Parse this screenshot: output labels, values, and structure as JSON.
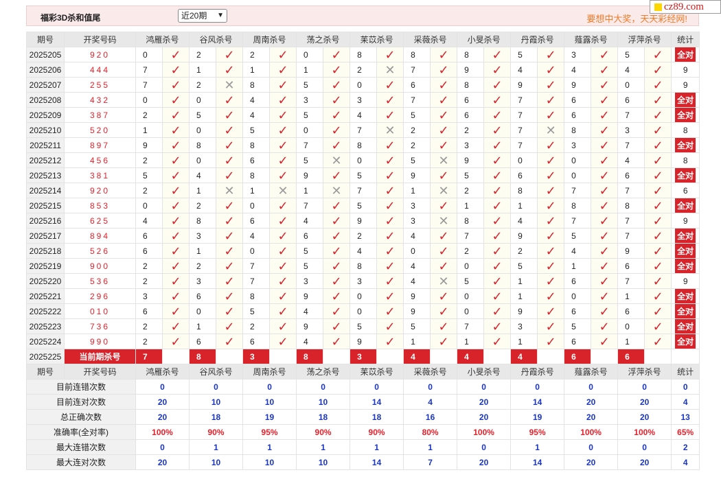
{
  "header": {
    "title": "福彩3D杀和值尾",
    "period_select": "近20期",
    "slogan": "要想中大奖，天天彩经网!"
  },
  "logo": {
    "text": "cz89.com"
  },
  "columns": {
    "period": "期号",
    "draw": "开奖号码",
    "experts": [
      "鸿雁杀号",
      "谷风杀号",
      "周南杀号",
      "荡之杀号",
      "苿苡杀号",
      "采薇杀号",
      "小旻杀号",
      "丹霞杀号",
      "薤露杀号",
      "浮萍杀号"
    ],
    "stat": "统计"
  },
  "rows": [
    {
      "period": "2025205",
      "draw": "920",
      "picks": [
        [
          "0",
          1
        ],
        [
          "2",
          1
        ],
        [
          "2",
          1
        ],
        [
          "0",
          1
        ],
        [
          "8",
          1
        ],
        [
          "8",
          1
        ],
        [
          "8",
          1
        ],
        [
          "5",
          1
        ],
        [
          "3",
          1
        ],
        [
          "5",
          1
        ]
      ],
      "stat": "全对"
    },
    {
      "period": "2025206",
      "draw": "444",
      "picks": [
        [
          "7",
          1
        ],
        [
          "1",
          1
        ],
        [
          "1",
          1
        ],
        [
          "1",
          1
        ],
        [
          "2",
          0
        ],
        [
          "7",
          1
        ],
        [
          "9",
          1
        ],
        [
          "4",
          1
        ],
        [
          "4",
          1
        ],
        [
          "4",
          1
        ]
      ],
      "stat": "9"
    },
    {
      "period": "2025207",
      "draw": "255",
      "picks": [
        [
          "7",
          1
        ],
        [
          "2",
          0
        ],
        [
          "8",
          1
        ],
        [
          "5",
          1
        ],
        [
          "0",
          1
        ],
        [
          "6",
          1
        ],
        [
          "8",
          1
        ],
        [
          "9",
          1
        ],
        [
          "9",
          1
        ],
        [
          "0",
          1
        ]
      ],
      "stat": "9"
    },
    {
      "period": "2025208",
      "draw": "432",
      "picks": [
        [
          "0",
          1
        ],
        [
          "0",
          1
        ],
        [
          "4",
          1
        ],
        [
          "3",
          1
        ],
        [
          "3",
          1
        ],
        [
          "7",
          1
        ],
        [
          "6",
          1
        ],
        [
          "7",
          1
        ],
        [
          "6",
          1
        ],
        [
          "6",
          1
        ]
      ],
      "stat": "全对"
    },
    {
      "period": "2025209",
      "draw": "387",
      "picks": [
        [
          "2",
          1
        ],
        [
          "5",
          1
        ],
        [
          "4",
          1
        ],
        [
          "5",
          1
        ],
        [
          "4",
          1
        ],
        [
          "5",
          1
        ],
        [
          "6",
          1
        ],
        [
          "7",
          1
        ],
        [
          "6",
          1
        ],
        [
          "7",
          1
        ]
      ],
      "stat": "全对"
    },
    {
      "period": "2025210",
      "draw": "520",
      "picks": [
        [
          "1",
          1
        ],
        [
          "0",
          1
        ],
        [
          "5",
          1
        ],
        [
          "0",
          1
        ],
        [
          "7",
          0
        ],
        [
          "2",
          1
        ],
        [
          "2",
          1
        ],
        [
          "7",
          0
        ],
        [
          "8",
          1
        ],
        [
          "3",
          1
        ]
      ],
      "stat": "8"
    },
    {
      "period": "2025211",
      "draw": "897",
      "picks": [
        [
          "9",
          1
        ],
        [
          "8",
          1
        ],
        [
          "8",
          1
        ],
        [
          "7",
          1
        ],
        [
          "8",
          1
        ],
        [
          "2",
          1
        ],
        [
          "3",
          1
        ],
        [
          "7",
          1
        ],
        [
          "3",
          1
        ],
        [
          "7",
          1
        ]
      ],
      "stat": "全对"
    },
    {
      "period": "2025212",
      "draw": "456",
      "picks": [
        [
          "2",
          1
        ],
        [
          "0",
          1
        ],
        [
          "6",
          1
        ],
        [
          "5",
          0
        ],
        [
          "0",
          1
        ],
        [
          "5",
          0
        ],
        [
          "9",
          1
        ],
        [
          "0",
          1
        ],
        [
          "0",
          1
        ],
        [
          "4",
          1
        ]
      ],
      "stat": "8"
    },
    {
      "period": "2025213",
      "draw": "381",
      "picks": [
        [
          "5",
          1
        ],
        [
          "4",
          1
        ],
        [
          "8",
          1
        ],
        [
          "9",
          1
        ],
        [
          "5",
          1
        ],
        [
          "9",
          1
        ],
        [
          "5",
          1
        ],
        [
          "6",
          1
        ],
        [
          "0",
          1
        ],
        [
          "6",
          1
        ]
      ],
      "stat": "全对"
    },
    {
      "period": "2025214",
      "draw": "920",
      "picks": [
        [
          "2",
          1
        ],
        [
          "1",
          0
        ],
        [
          "1",
          0
        ],
        [
          "1",
          0
        ],
        [
          "7",
          1
        ],
        [
          "1",
          0
        ],
        [
          "2",
          1
        ],
        [
          "8",
          1
        ],
        [
          "7",
          1
        ],
        [
          "7",
          1
        ]
      ],
      "stat": "6"
    },
    {
      "period": "2025215",
      "draw": "853",
      "picks": [
        [
          "0",
          1
        ],
        [
          "2",
          1
        ],
        [
          "0",
          1
        ],
        [
          "7",
          1
        ],
        [
          "5",
          1
        ],
        [
          "3",
          1
        ],
        [
          "1",
          1
        ],
        [
          "1",
          1
        ],
        [
          "8",
          1
        ],
        [
          "8",
          1
        ]
      ],
      "stat": "全对"
    },
    {
      "period": "2025216",
      "draw": "625",
      "picks": [
        [
          "4",
          1
        ],
        [
          "8",
          1
        ],
        [
          "6",
          1
        ],
        [
          "4",
          1
        ],
        [
          "9",
          1
        ],
        [
          "3",
          0
        ],
        [
          "8",
          1
        ],
        [
          "4",
          1
        ],
        [
          "7",
          1
        ],
        [
          "7",
          1
        ]
      ],
      "stat": "9"
    },
    {
      "period": "2025217",
      "draw": "894",
      "picks": [
        [
          "6",
          1
        ],
        [
          "3",
          1
        ],
        [
          "4",
          1
        ],
        [
          "6",
          1
        ],
        [
          "2",
          1
        ],
        [
          "4",
          1
        ],
        [
          "7",
          1
        ],
        [
          "9",
          1
        ],
        [
          "5",
          1
        ],
        [
          "7",
          1
        ]
      ],
      "stat": "全对"
    },
    {
      "period": "2025218",
      "draw": "526",
      "picks": [
        [
          "6",
          1
        ],
        [
          "1",
          1
        ],
        [
          "0",
          1
        ],
        [
          "5",
          1
        ],
        [
          "4",
          1
        ],
        [
          "0",
          1
        ],
        [
          "2",
          1
        ],
        [
          "2",
          1
        ],
        [
          "4",
          1
        ],
        [
          "9",
          1
        ]
      ],
      "stat": "全对"
    },
    {
      "period": "2025219",
      "draw": "900",
      "picks": [
        [
          "2",
          1
        ],
        [
          "2",
          1
        ],
        [
          "7",
          1
        ],
        [
          "5",
          1
        ],
        [
          "8",
          1
        ],
        [
          "4",
          1
        ],
        [
          "0",
          1
        ],
        [
          "5",
          1
        ],
        [
          "1",
          1
        ],
        [
          "6",
          1
        ]
      ],
      "stat": "全对"
    },
    {
      "period": "2025220",
      "draw": "536",
      "picks": [
        [
          "2",
          1
        ],
        [
          "3",
          1
        ],
        [
          "7",
          1
        ],
        [
          "3",
          1
        ],
        [
          "3",
          1
        ],
        [
          "4",
          0
        ],
        [
          "5",
          1
        ],
        [
          "1",
          1
        ],
        [
          "6",
          1
        ],
        [
          "7",
          1
        ]
      ],
      "stat": "9"
    },
    {
      "period": "2025221",
      "draw": "296",
      "picks": [
        [
          "3",
          1
        ],
        [
          "6",
          1
        ],
        [
          "8",
          1
        ],
        [
          "9",
          1
        ],
        [
          "0",
          1
        ],
        [
          "9",
          1
        ],
        [
          "0",
          1
        ],
        [
          "1",
          1
        ],
        [
          "0",
          1
        ],
        [
          "1",
          1
        ]
      ],
      "stat": "全对"
    },
    {
      "period": "2025222",
      "draw": "010",
      "picks": [
        [
          "6",
          1
        ],
        [
          "0",
          1
        ],
        [
          "5",
          1
        ],
        [
          "4",
          1
        ],
        [
          "0",
          1
        ],
        [
          "9",
          1
        ],
        [
          "0",
          1
        ],
        [
          "9",
          1
        ],
        [
          "6",
          1
        ],
        [
          "6",
          1
        ]
      ],
      "stat": "全对"
    },
    {
      "period": "2025223",
      "draw": "736",
      "picks": [
        [
          "2",
          1
        ],
        [
          "1",
          1
        ],
        [
          "2",
          1
        ],
        [
          "9",
          1
        ],
        [
          "5",
          1
        ],
        [
          "5",
          1
        ],
        [
          "7",
          1
        ],
        [
          "3",
          1
        ],
        [
          "5",
          1
        ],
        [
          "0",
          1
        ]
      ],
      "stat": "全对"
    },
    {
      "period": "2025224",
      "draw": "990",
      "picks": [
        [
          "2",
          1
        ],
        [
          "6",
          1
        ],
        [
          "6",
          1
        ],
        [
          "4",
          1
        ],
        [
          "9",
          1
        ],
        [
          "1",
          1
        ],
        [
          "1",
          1
        ],
        [
          "1",
          1
        ],
        [
          "6",
          1
        ],
        [
          "1",
          1
        ]
      ],
      "stat": "全对"
    }
  ],
  "current": {
    "period": "2025225",
    "label": "当前期杀号",
    "picks": [
      "7",
      "8",
      "3",
      "8",
      "3",
      "4",
      "4",
      "4",
      "6",
      "6"
    ]
  },
  "summary": [
    {
      "label": "目前连错次数",
      "values": [
        "0",
        "0",
        "0",
        "0",
        "0",
        "0",
        "0",
        "0",
        "0",
        "0"
      ],
      "stat": "0"
    },
    {
      "label": "目前连对次数",
      "values": [
        "20",
        "10",
        "10",
        "10",
        "14",
        "4",
        "20",
        "14",
        "20",
        "20"
      ],
      "stat": "4"
    },
    {
      "label": "总正确次数",
      "values": [
        "20",
        "18",
        "19",
        "18",
        "18",
        "16",
        "20",
        "19",
        "20",
        "20"
      ],
      "stat": "13"
    },
    {
      "label": "准确率(全对率)",
      "values": [
        "100%",
        "90%",
        "95%",
        "90%",
        "90%",
        "80%",
        "100%",
        "95%",
        "100%",
        "100%"
      ],
      "stat": "65%",
      "accent": true
    },
    {
      "label": "最大连错次数",
      "values": [
        "0",
        "1",
        "1",
        "1",
        "1",
        "1",
        "0",
        "1",
        "0",
        "0"
      ],
      "stat": "2"
    },
    {
      "label": "最大连对次数",
      "values": [
        "20",
        "10",
        "10",
        "10",
        "14",
        "7",
        "20",
        "14",
        "20",
        "20"
      ],
      "stat": "4"
    }
  ],
  "marks": {
    "correct": "✓",
    "wrong": "✕"
  },
  "colors": {
    "accent_red": "#d8232a",
    "summary_blue": "#1a35c4",
    "slogan_orange": "#f07c28"
  }
}
